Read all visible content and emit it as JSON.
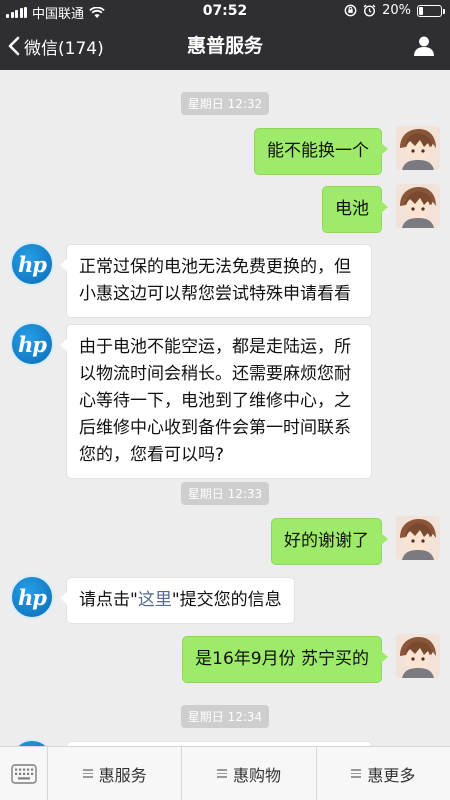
{
  "status": {
    "carrier": "中国联通",
    "time": "07:52",
    "battery": "20%",
    "battery_level": 0.2
  },
  "nav": {
    "back_label": "微信(174)",
    "title": "惠普服务"
  },
  "chat": {
    "timestamps": [
      "星期日 12:32",
      "星期日 12:33",
      "星期日 12:34"
    ],
    "messages": [
      {
        "side": "right",
        "text": "能不能换一个"
      },
      {
        "side": "right",
        "text": "电池"
      },
      {
        "side": "left",
        "lines": [
          "正常过保的电池无法免费更换的，但",
          "小惠这边可以帮您尝试特殊申请看看"
        ]
      },
      {
        "side": "left",
        "lines": [
          "由于电池不能空运，都是走陆运，所",
          "以物流时间会稍长。还需要麻烦您耐",
          "心等待一下，电池到了维修中心，之",
          "后维修中心收到备件会第一时间联系",
          "您的，您看可以吗?"
        ]
      },
      {
        "side": "right",
        "text": "好的谢谢了"
      },
      {
        "side": "left",
        "prefix": "请点击\"",
        "link": "这里",
        "suffix": "\"提交您的信息"
      },
      {
        "side": "right",
        "text": "是16年9月份 苏宁买的"
      }
    ],
    "hp_logo_text": "hp"
  },
  "bottom_menu": {
    "items": [
      "惠服务",
      "惠购物",
      "惠更多"
    ]
  }
}
